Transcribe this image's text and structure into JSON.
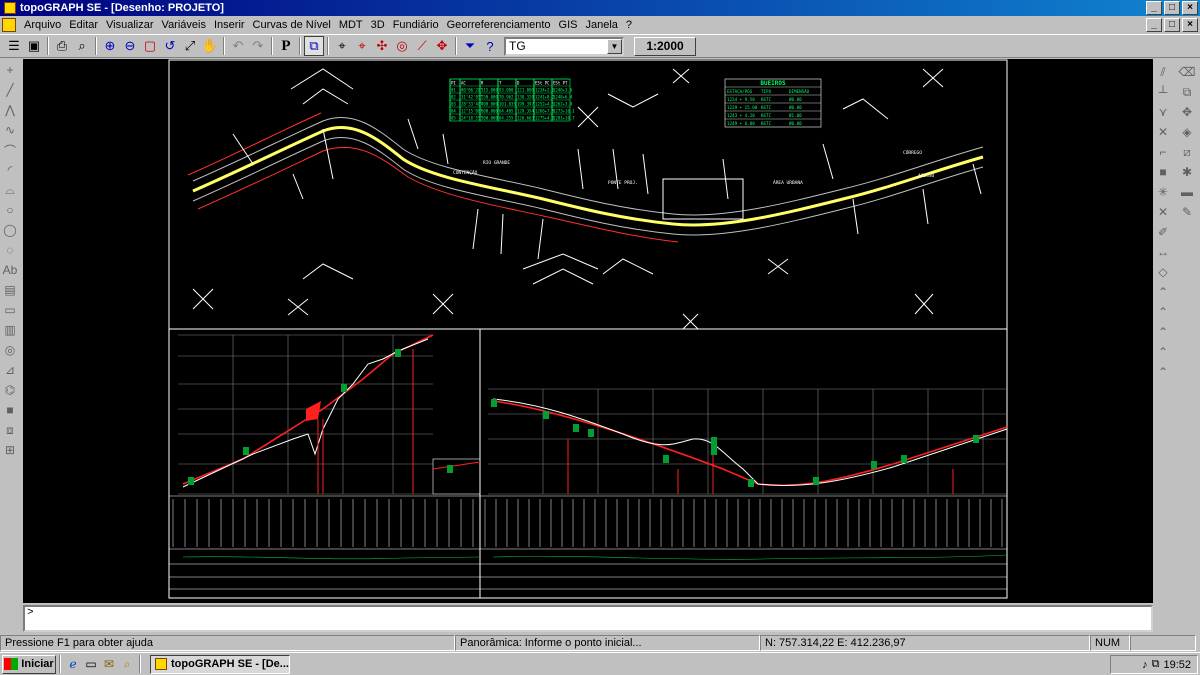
{
  "window": {
    "title": "topoGRAPH SE - [Desenho: PROJETO]",
    "minimize": "_",
    "maximize": "□",
    "close": "×"
  },
  "menu": [
    "Arquivo",
    "Editar",
    "Visualizar",
    "Variáveis",
    "Inserir",
    "Curvas de Nível",
    "MDT",
    "3D",
    "Fundiário",
    "Georreferenciamento",
    "GIS",
    "Janela",
    "?"
  ],
  "toolbar": {
    "layer_value": "TG",
    "layer_arrow": "▼",
    "scale_label": "1:2000",
    "print_label": "P"
  },
  "drawing": {
    "culverts_title": "BUEIROS",
    "culvert_headers": [
      "ESTACA/POS",
      "TIPO",
      "DIMENSÃO"
    ],
    "culvert_rows": [
      [
        "1234 + 9.50",
        "BSTC",
        "Ø0.80"
      ],
      [
        "1239 + 15.00",
        "BSTC",
        "Ø0.80"
      ],
      [
        "1243 + 4.20",
        "BSTC",
        "Ø1.00"
      ],
      [
        "1249 + 6.80",
        "BSTC",
        "Ø0.80"
      ]
    ],
    "curve_table_headers": [
      "PI",
      "AC",
      "R",
      "T",
      "D",
      "ESt PC",
      "ESt PT"
    ],
    "curve_table_rows": [
      [
        "01",
        "80°06'20\"",
        "115.000",
        "93.000",
        "121.000",
        "1234+2.6",
        "1240+3.6"
      ],
      [
        "02",
        "31°42'05\"",
        "250.000",
        "70.962",
        "138.320",
        "1241+8.1",
        "1248+6.4"
      ],
      [
        "03",
        "28°33'40\"",
        "400.000",
        "101.835",
        "199.397",
        "1252+4.5",
        "1262+3.9"
      ],
      [
        "04",
        "12°15'08\"",
        "600.000",
        "64.405",
        "128.354",
        "1266+7.8",
        "1273+16.1"
      ],
      [
        "05",
        "24°10'55\"",
        "300.000",
        "64.255",
        "126.663",
        "1275+4.0",
        "1281+10.7"
      ]
    ],
    "section_labels": [
      "CONTENÇÃO",
      "RIO GRANDE",
      "PONTE PROJ.",
      "ÁREA URBANA",
      "CÓRREGO",
      "ACESSO"
    ]
  },
  "command_prompt": ">",
  "status": {
    "help": "Pressione F1 para obter ajuda",
    "action": "Panorâmica: Informe o ponto inicial...",
    "coords": "N: 757.314,22 E: 412.236,97",
    "num": "NUM"
  },
  "taskbar": {
    "start_label": "Iniciar",
    "task_label": "topoGRAPH SE - [De...",
    "clock": "19:52"
  },
  "colors": {
    "title_start": "#000080",
    "title_end": "#1084d0",
    "canvas_bg": "#000000",
    "alignment": "#ffff66",
    "profile": "#ff2020",
    "table_green": "#00ff66"
  }
}
